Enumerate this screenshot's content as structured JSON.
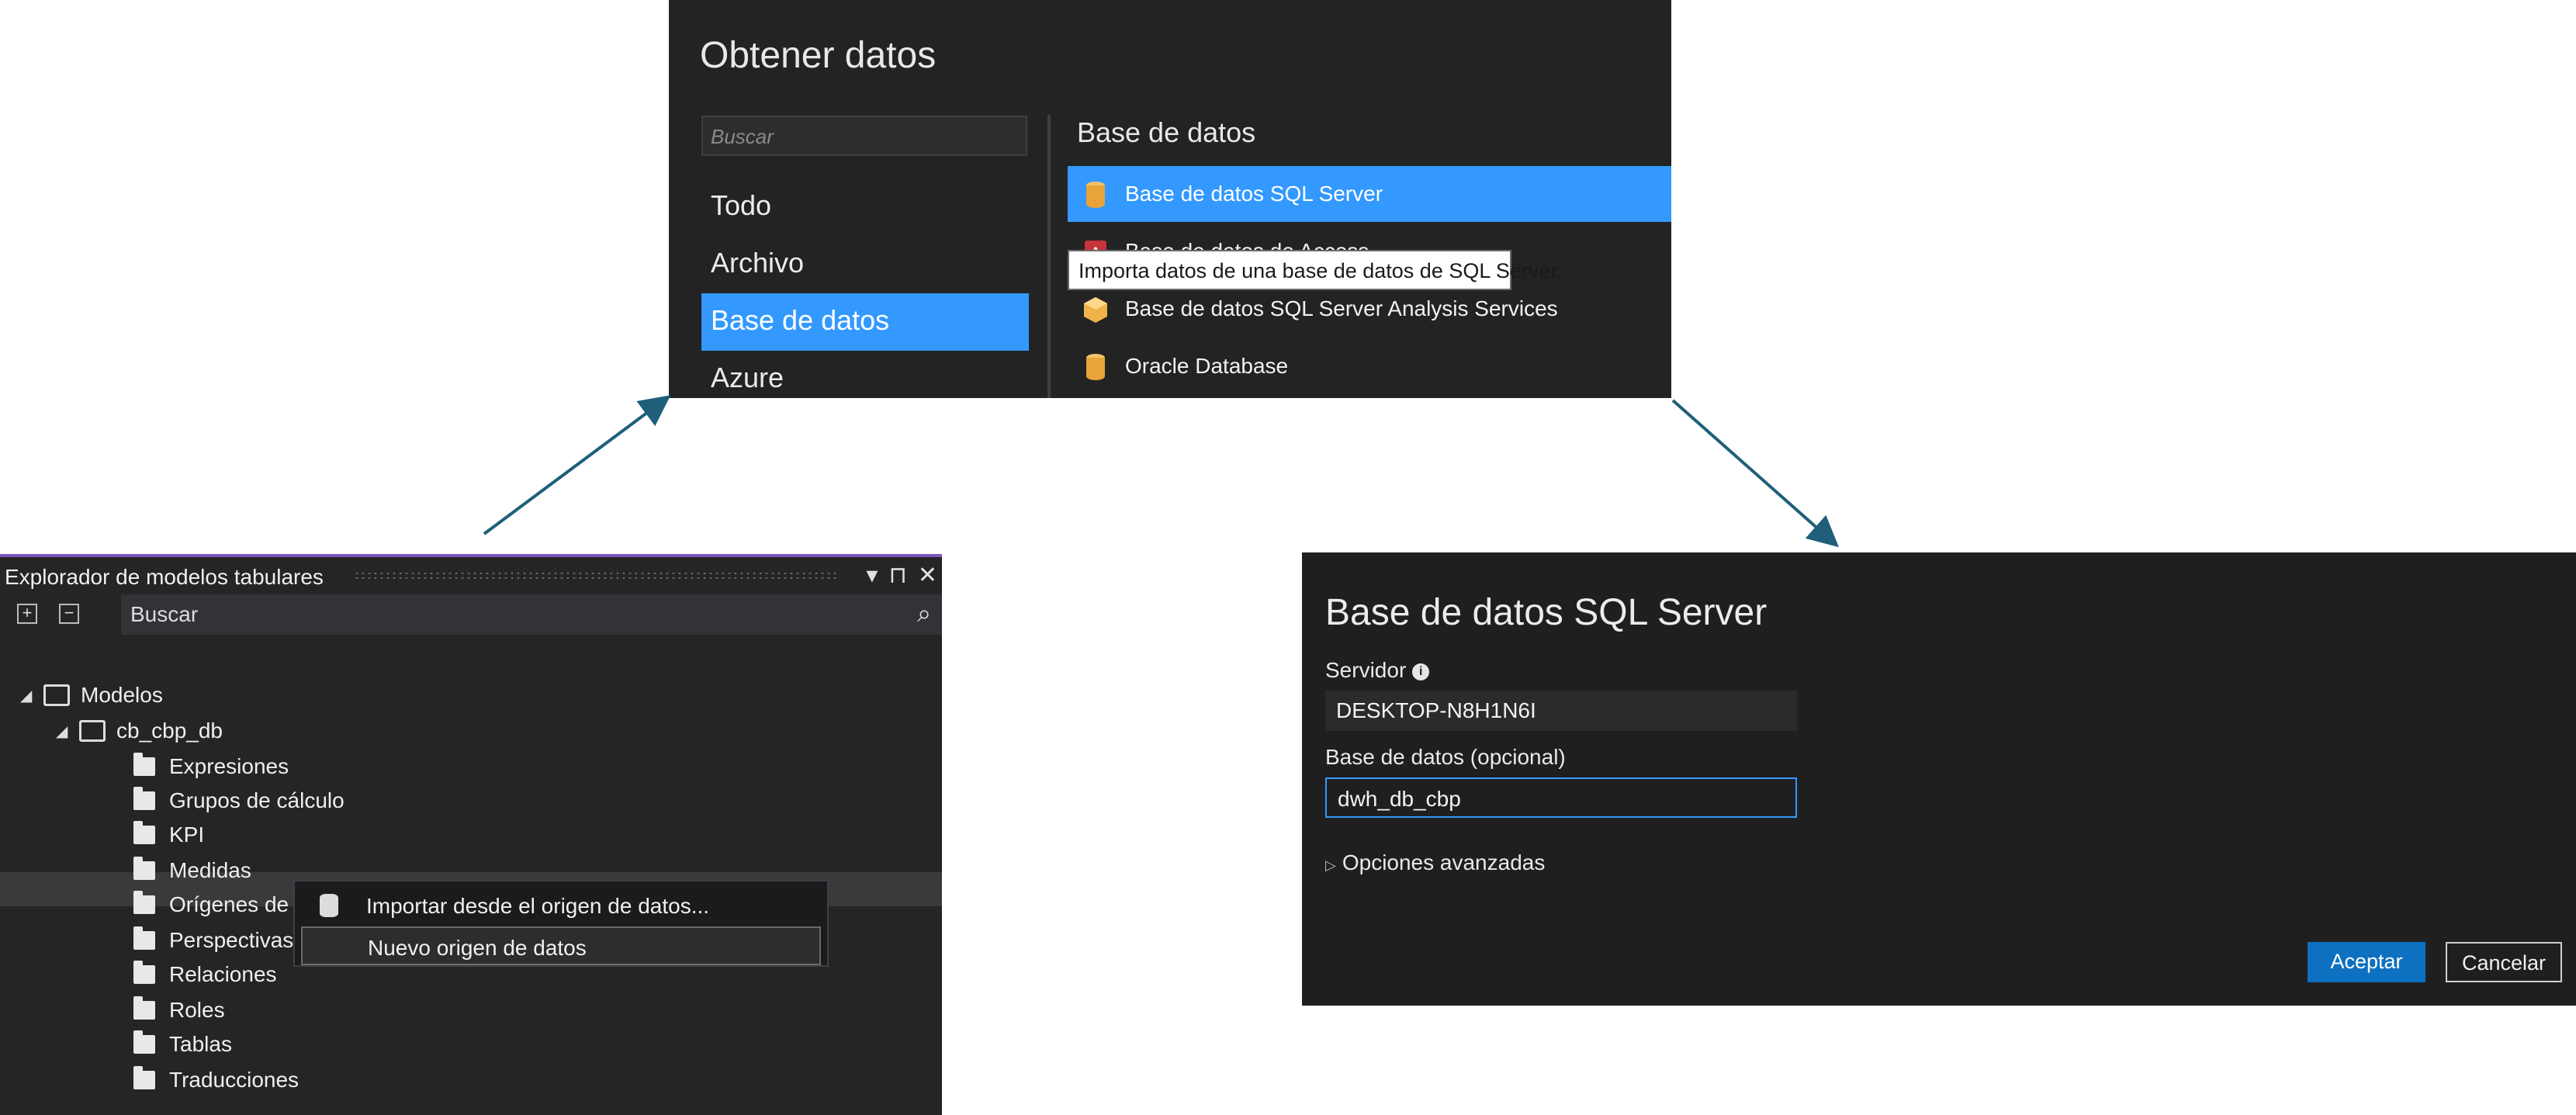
{
  "get_data": {
    "title": "Obtener datos",
    "search_placeholder": "Buscar",
    "categories": [
      "Todo",
      "Archivo",
      "Base de datos",
      "Azure"
    ],
    "selected_category": "Base de datos",
    "section_title": "Base de datos",
    "sources": [
      {
        "label": "Base de datos SQL Server",
        "icon": "cylinder-icon",
        "selected": true
      },
      {
        "label": "Base de datos de Access",
        "icon": "access-icon",
        "selected": false
      },
      {
        "label": "Base de datos SQL Server Analysis Services",
        "icon": "cube-icon",
        "selected": false
      },
      {
        "label": "Oracle Database",
        "icon": "cylinder-icon",
        "selected": false
      }
    ],
    "tooltip": "Importa datos de una base de datos de SQL Server."
  },
  "explorer": {
    "title": "Explorador de modelos tabulares",
    "title_icons": [
      "▾",
      "⊓",
      "✕"
    ],
    "search_placeholder": "Buscar",
    "search_icon": "⌕",
    "root": "Modelos",
    "model": "cb_cbp_db",
    "items": [
      "Expresiones",
      "Grupos de cálculo",
      "KPI",
      "Medidas",
      "Orígenes de datos",
      "Perspectivas",
      "Relaciones",
      "Roles",
      "Tablas",
      "Traducciones"
    ],
    "context_menu": [
      {
        "label": "Importar desde el origen de datos..."
      },
      {
        "label": "Nuevo origen de datos"
      }
    ]
  },
  "sql_dialog": {
    "title": "Base de datos SQL Server",
    "server_label": "Servidor",
    "server_value": "DESKTOP-N8H1N6I",
    "database_label": "Base de datos (opcional)",
    "database_value": "dwh_db_cbp",
    "advanced_label": "Opciones avanzadas",
    "ok_label": "Aceptar",
    "cancel_label": "Cancelar"
  },
  "colors": {
    "accent_blue": "#3399ff",
    "arrow": "#1f5f7a",
    "ok_button": "#0e70c0",
    "tab_purple": "#7e57c2"
  }
}
